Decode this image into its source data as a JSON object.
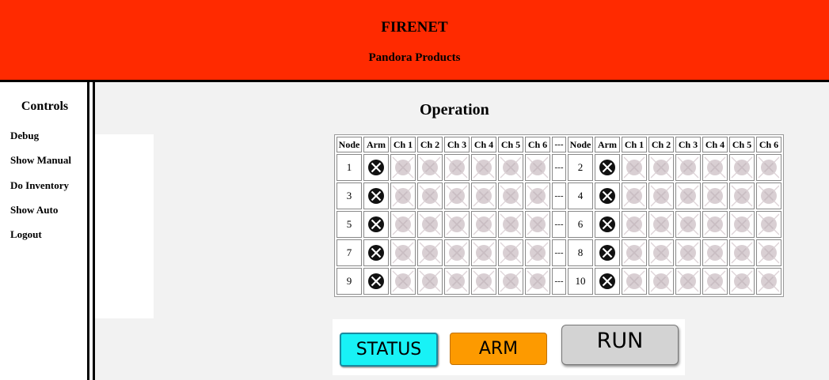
{
  "header": {
    "title": "FIRENET",
    "subtitle": "Pandora Products"
  },
  "sidebar": {
    "title": "Controls",
    "links": [
      {
        "label": "Debug"
      },
      {
        "label": "Show Manual"
      },
      {
        "label": "Do Inventory"
      },
      {
        "label": "Show Auto"
      },
      {
        "label": "Logout"
      }
    ]
  },
  "main": {
    "title": "Operation"
  },
  "table": {
    "headers": [
      "Node",
      "Arm",
      "Ch 1",
      "Ch 2",
      "Ch 3",
      "Ch 4",
      "Ch 5",
      "Ch 6",
      "---",
      "Node",
      "Arm",
      "Ch 1",
      "Ch 2",
      "Ch 3",
      "Ch 4",
      "Ch 5",
      "Ch 6"
    ],
    "separator": "---",
    "rows": [
      {
        "left": {
          "node": "1",
          "arm_icon": "armed-icon",
          "channel_icon": "disabled-channel-icon"
        },
        "right": {
          "node": "2",
          "arm_icon": "armed-icon",
          "channel_icon": "disabled-channel-icon"
        }
      },
      {
        "left": {
          "node": "3",
          "arm_icon": "armed-icon",
          "channel_icon": "disabled-channel-icon"
        },
        "right": {
          "node": "4",
          "arm_icon": "armed-icon",
          "channel_icon": "disabled-channel-icon"
        }
      },
      {
        "left": {
          "node": "5",
          "arm_icon": "armed-icon",
          "channel_icon": "disabled-channel-icon"
        },
        "right": {
          "node": "6",
          "arm_icon": "armed-icon",
          "channel_icon": "disabled-channel-icon"
        }
      },
      {
        "left": {
          "node": "7",
          "arm_icon": "armed-icon",
          "channel_icon": "disabled-channel-icon"
        },
        "right": {
          "node": "8",
          "arm_icon": "armed-icon",
          "channel_icon": "disabled-channel-icon"
        }
      },
      {
        "left": {
          "node": "9",
          "arm_icon": "armed-icon",
          "channel_icon": "disabled-channel-icon"
        },
        "right": {
          "node": "10",
          "arm_icon": "armed-icon",
          "channel_icon": "disabled-channel-icon"
        }
      }
    ]
  },
  "buttons": {
    "status": {
      "label": "STATUS",
      "color": "#18f2f6"
    },
    "arm": {
      "label": "ARM",
      "color": "#fd9a00"
    },
    "run": {
      "label": "RUN",
      "color": "#d3d3d3"
    }
  },
  "colors": {
    "header_bg": "#ff2a00",
    "main_bg": "#f2f2f2",
    "channel_disabled": "#d9cfd3"
  }
}
